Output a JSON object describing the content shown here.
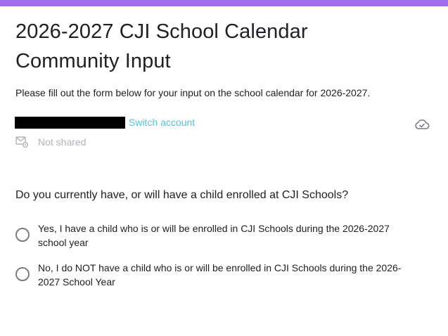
{
  "colors": {
    "accent": "#a06ee8",
    "link": "#56c3d6",
    "muted_text": "#b0b3b7",
    "radio_border": "#7a7d80"
  },
  "form": {
    "title": "2026-2027 CJI School Calendar Community Input",
    "description": "Please fill out the form below for your input on the school calendar for 2026-2027."
  },
  "account": {
    "switch_label": "Switch account",
    "sharing_status": "Not shared",
    "sharing_icon": "mail-settings-icon",
    "save_status_icon": "cloud-check-icon"
  },
  "question": {
    "text": "Do you currently have, or will have a child enrolled at CJI Schools?",
    "options": [
      {
        "label": "Yes, I have a child who is or will be enrolled in CJI Schools during the 2026-2027 school year",
        "selected": false
      },
      {
        "label": "No, I do NOT have a child who is or will be enrolled in CJI Schools during the 2026-2027 School Year",
        "selected": false
      }
    ]
  }
}
